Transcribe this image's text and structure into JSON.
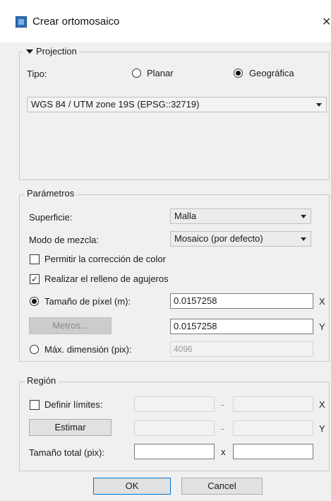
{
  "window": {
    "title": "Crear ortomosaico",
    "close_glyph": "✕"
  },
  "projection": {
    "section_title": "Projection",
    "type_label": "Tipo:",
    "options": [
      "Planar",
      "Geográfica"
    ],
    "selected_option": "Geográfica",
    "crs_value": "WGS 84 / UTM zone 19S (EPSG::32719)"
  },
  "parameters": {
    "section_title": "Parámetros",
    "surface_label": "Superficie:",
    "surface_value": "Malla",
    "blend_label": "Modo de mezcla:",
    "blend_value": "Mosaico (por defecto)",
    "color_correction_label": "Permitir la corrección de color",
    "color_correction_checked": false,
    "hole_filling_label": "Realizar el relleno de agujeros",
    "hole_filling_checked": true,
    "pixel_size_label": "Tamaño de píxel (m):",
    "pixel_size_x": "0.0157258",
    "pixel_size_y": "0.0157258",
    "meters_button": "Metros...",
    "max_dim_label": "Máx. dimensión (pix):",
    "max_dim_value": "4096",
    "x_axis": "X",
    "y_axis": "Y"
  },
  "region": {
    "section_title": "Región",
    "define_limits_label": "Definir límites:",
    "define_limits_checked": false,
    "estimate_button": "Estimar",
    "dash": "-",
    "x_axis": "X",
    "y_axis": "Y",
    "total_size_label": "Tamaño total (pix):",
    "times": "x"
  },
  "footer": {
    "ok_label": "OK",
    "cancel_label": "Cancel"
  }
}
